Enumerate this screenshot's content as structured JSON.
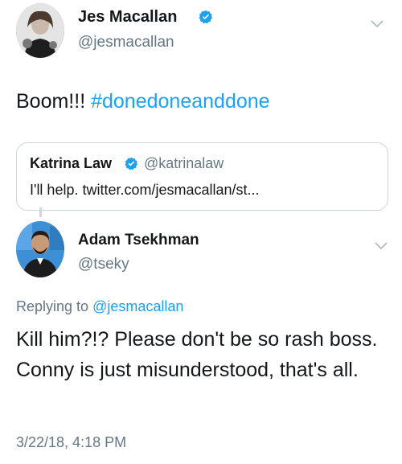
{
  "tweet": {
    "author": {
      "name": "Jes Macallan",
      "handle": "@jesmacallan",
      "verified": true,
      "avatar_icon": "avatar-photo-woman"
    },
    "text_prefix": "Boom!!! ",
    "hashtag": "#donedoneanddone",
    "quoted": {
      "name": "Katrina Law",
      "handle": "@katrinalaw",
      "verified": true,
      "text": "I'll help. twitter.com/jesmacallan/st..."
    }
  },
  "reply": {
    "author": {
      "name": "Adam Tsekhman",
      "handle": "@tseky",
      "avatar_icon": "avatar-photo-man"
    },
    "replying_label": "Replying to ",
    "replying_to": "@jesmacallan",
    "text": "Kill him?!? Please don't be so rash boss. Conny is just misunderstood, that's all.",
    "timestamp": "3/22/18, 4:18 PM"
  },
  "colors": {
    "accent": "#1da1f2",
    "secondary_text": "#657786",
    "border": "#ccd6dd",
    "primary_text": "#14171a"
  }
}
